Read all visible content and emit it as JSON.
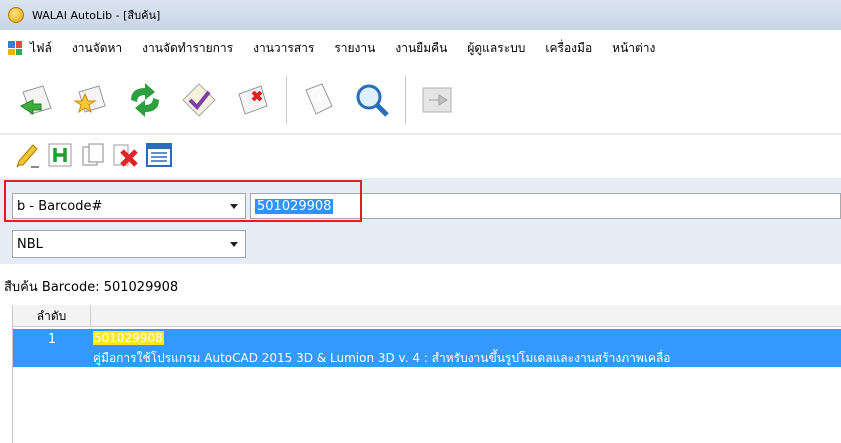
{
  "window": {
    "title": "WALAI AutoLib - [สืบค้น]"
  },
  "menu": [
    "ไฟล์",
    "งานจัดหา",
    "งานจัดทำรายการ",
    "งานวารสาร",
    "รายงาน",
    "งานยืมคืน",
    "ผู้ดูแลระบบ",
    "เครื่องมือ",
    "หน้าต่าง"
  ],
  "toolbar": {
    "buttons": [
      "import-icon",
      "star-folder-icon",
      "recycle-icon",
      "checkmark-icon",
      "delete-icon",
      "page-icon",
      "magnifier-icon",
      "export-icon"
    ]
  },
  "toolbar2": {
    "buttons": [
      "edit-pencil-icon",
      "header-h-icon",
      "copy-pages-icon",
      "delete-x-icon",
      "list-view-icon"
    ]
  },
  "search": {
    "field_select": "b - Barcode#",
    "query_value": "501029908",
    "library_select": "NBL"
  },
  "results": {
    "label": "สืบค้น Barcode: 501029908",
    "column_header": "ลำดับ",
    "rows": [
      {
        "index": "1",
        "barcode": "501029908",
        "title": "คู่มือการใช้โปรแกรม AutoCAD 2015 3D & Lumion 3D v. 4 : สำหรับงานขึ้นรูปโมเดลและงานสร้างภาพเคลื่อ"
      }
    ]
  },
  "colors": {
    "highlight_border": "#e02020",
    "selection": "#3399ff",
    "match": "#f7e62a"
  }
}
